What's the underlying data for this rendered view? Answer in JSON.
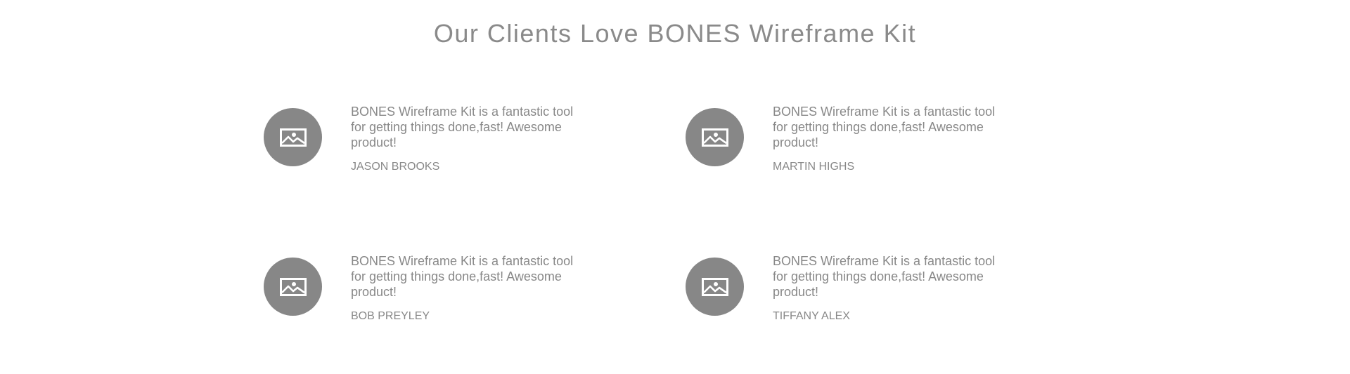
{
  "section": {
    "title": "Our Clients Love BONES Wireframe Kit"
  },
  "colors": {
    "text": "#888888",
    "avatar_bg": "#878787",
    "background": "#ffffff"
  },
  "testimonials": [
    {
      "quote": "BONES Wireframe Kit is a fantastic tool for getting things done,fast! Awesome product!",
      "author": "JASON BROOKS",
      "avatar_icon": "image-placeholder-icon"
    },
    {
      "quote": "BONES Wireframe Kit is a fantastic tool for getting things done,fast! Awesome product!",
      "author": "MARTIN HIGHS",
      "avatar_icon": "image-placeholder-icon"
    },
    {
      "quote": "BONES Wireframe Kit is a fantastic tool for getting things done,fast! Awesome product!",
      "author": "BOB PREYLEY",
      "avatar_icon": "image-placeholder-icon"
    },
    {
      "quote": "BONES Wireframe Kit is a fantastic tool for getting things done,fast! Awesome product!",
      "author": "TIFFANY ALEX",
      "avatar_icon": "image-placeholder-icon"
    }
  ]
}
